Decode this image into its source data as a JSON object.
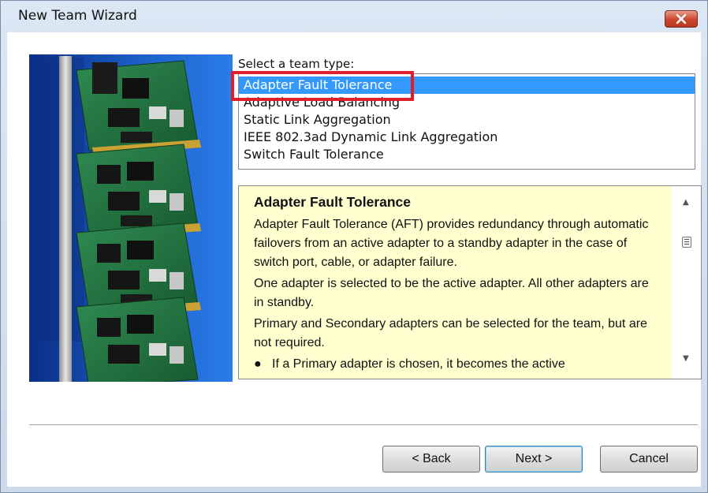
{
  "window": {
    "title": "New Team Wizard",
    "close_icon": "close-icon"
  },
  "team_type": {
    "label": "Select a team type:",
    "selected": "Adapter Fault Tolerance",
    "options": [
      "Adapter Fault Tolerance",
      "Adaptive Load Balancing",
      "Static Link Aggregation",
      "IEEE 802.3ad Dynamic Link Aggregation",
      "Switch Fault Tolerance"
    ]
  },
  "description": {
    "title": "Adapter Fault Tolerance",
    "paragraphs": [
      "Adapter Fault Tolerance (AFT) provides redundancy through automatic failovers from an active adapter to a standby adapter in the case of switch port, cable, or adapter failure.",
      "One adapter is selected to be the active adapter. All other adapters are in standby.",
      "Primary and Secondary adapters can be selected for the team, but are not required."
    ],
    "bullet": "If a Primary adapter is chosen, it becomes the active"
  },
  "buttons": {
    "back": "< Back",
    "next": "Next >",
    "cancel": "Cancel"
  },
  "colors": {
    "selection": "#3399ff",
    "description_bg": "#ffffd0",
    "highlight": "#e01f2a"
  }
}
